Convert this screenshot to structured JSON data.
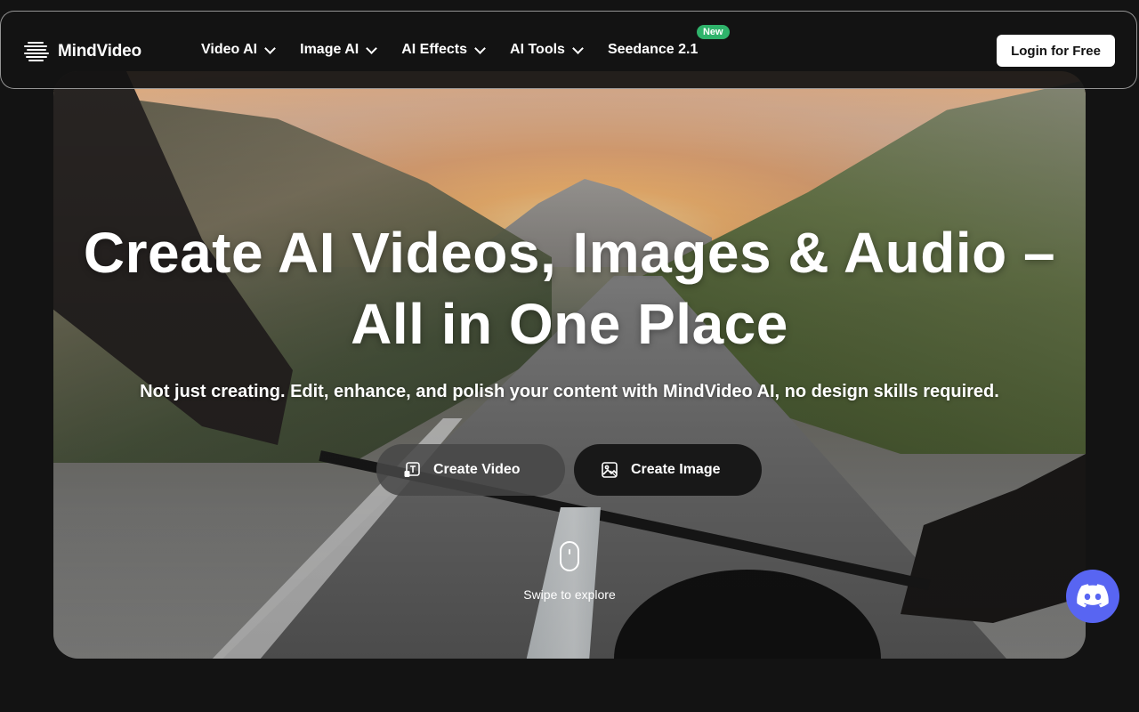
{
  "brand": {
    "name": "MindVideo"
  },
  "nav": {
    "items": [
      {
        "label": "Video AI",
        "has_dropdown": true
      },
      {
        "label": "Image AI",
        "has_dropdown": true
      },
      {
        "label": "AI Effects",
        "has_dropdown": true
      },
      {
        "label": "AI Tools",
        "has_dropdown": true
      },
      {
        "label": "Seedance 2.1",
        "badge": "New"
      }
    ],
    "login_label": "Login for Free"
  },
  "hero": {
    "headline_line1": "Create AI Videos, Images & Audio –",
    "headline_line2": "All in One Place",
    "subline": "Not just creating. Edit, enhance, and polish your content with MindVideo AI, no design skills required.",
    "cta_video": "Create Video",
    "cta_image": "Create Image",
    "swipe_text": "Swipe to explore"
  },
  "colors": {
    "background": "#131313",
    "badge_new": "#2fb36b",
    "discord": "#5865f2"
  },
  "icons": {
    "discord": "discord-icon",
    "scroll": "mouse-icon"
  }
}
